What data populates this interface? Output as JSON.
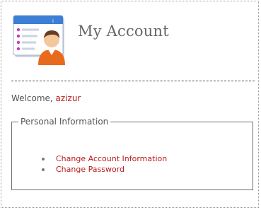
{
  "header": {
    "title": "My Account",
    "icon": "account-card-icon"
  },
  "welcome": {
    "prefix": "Welcome, ",
    "username": "azizur"
  },
  "personal_info": {
    "legend": "Personal Information",
    "links": [
      {
        "label": "Change Account Information"
      },
      {
        "label": "Change Password"
      }
    ]
  },
  "colors": {
    "link": "#b81c1c",
    "text": "#555555",
    "title": "#666666",
    "icon_blue": "#3d7fd6",
    "icon_person": "#e86a1c"
  }
}
